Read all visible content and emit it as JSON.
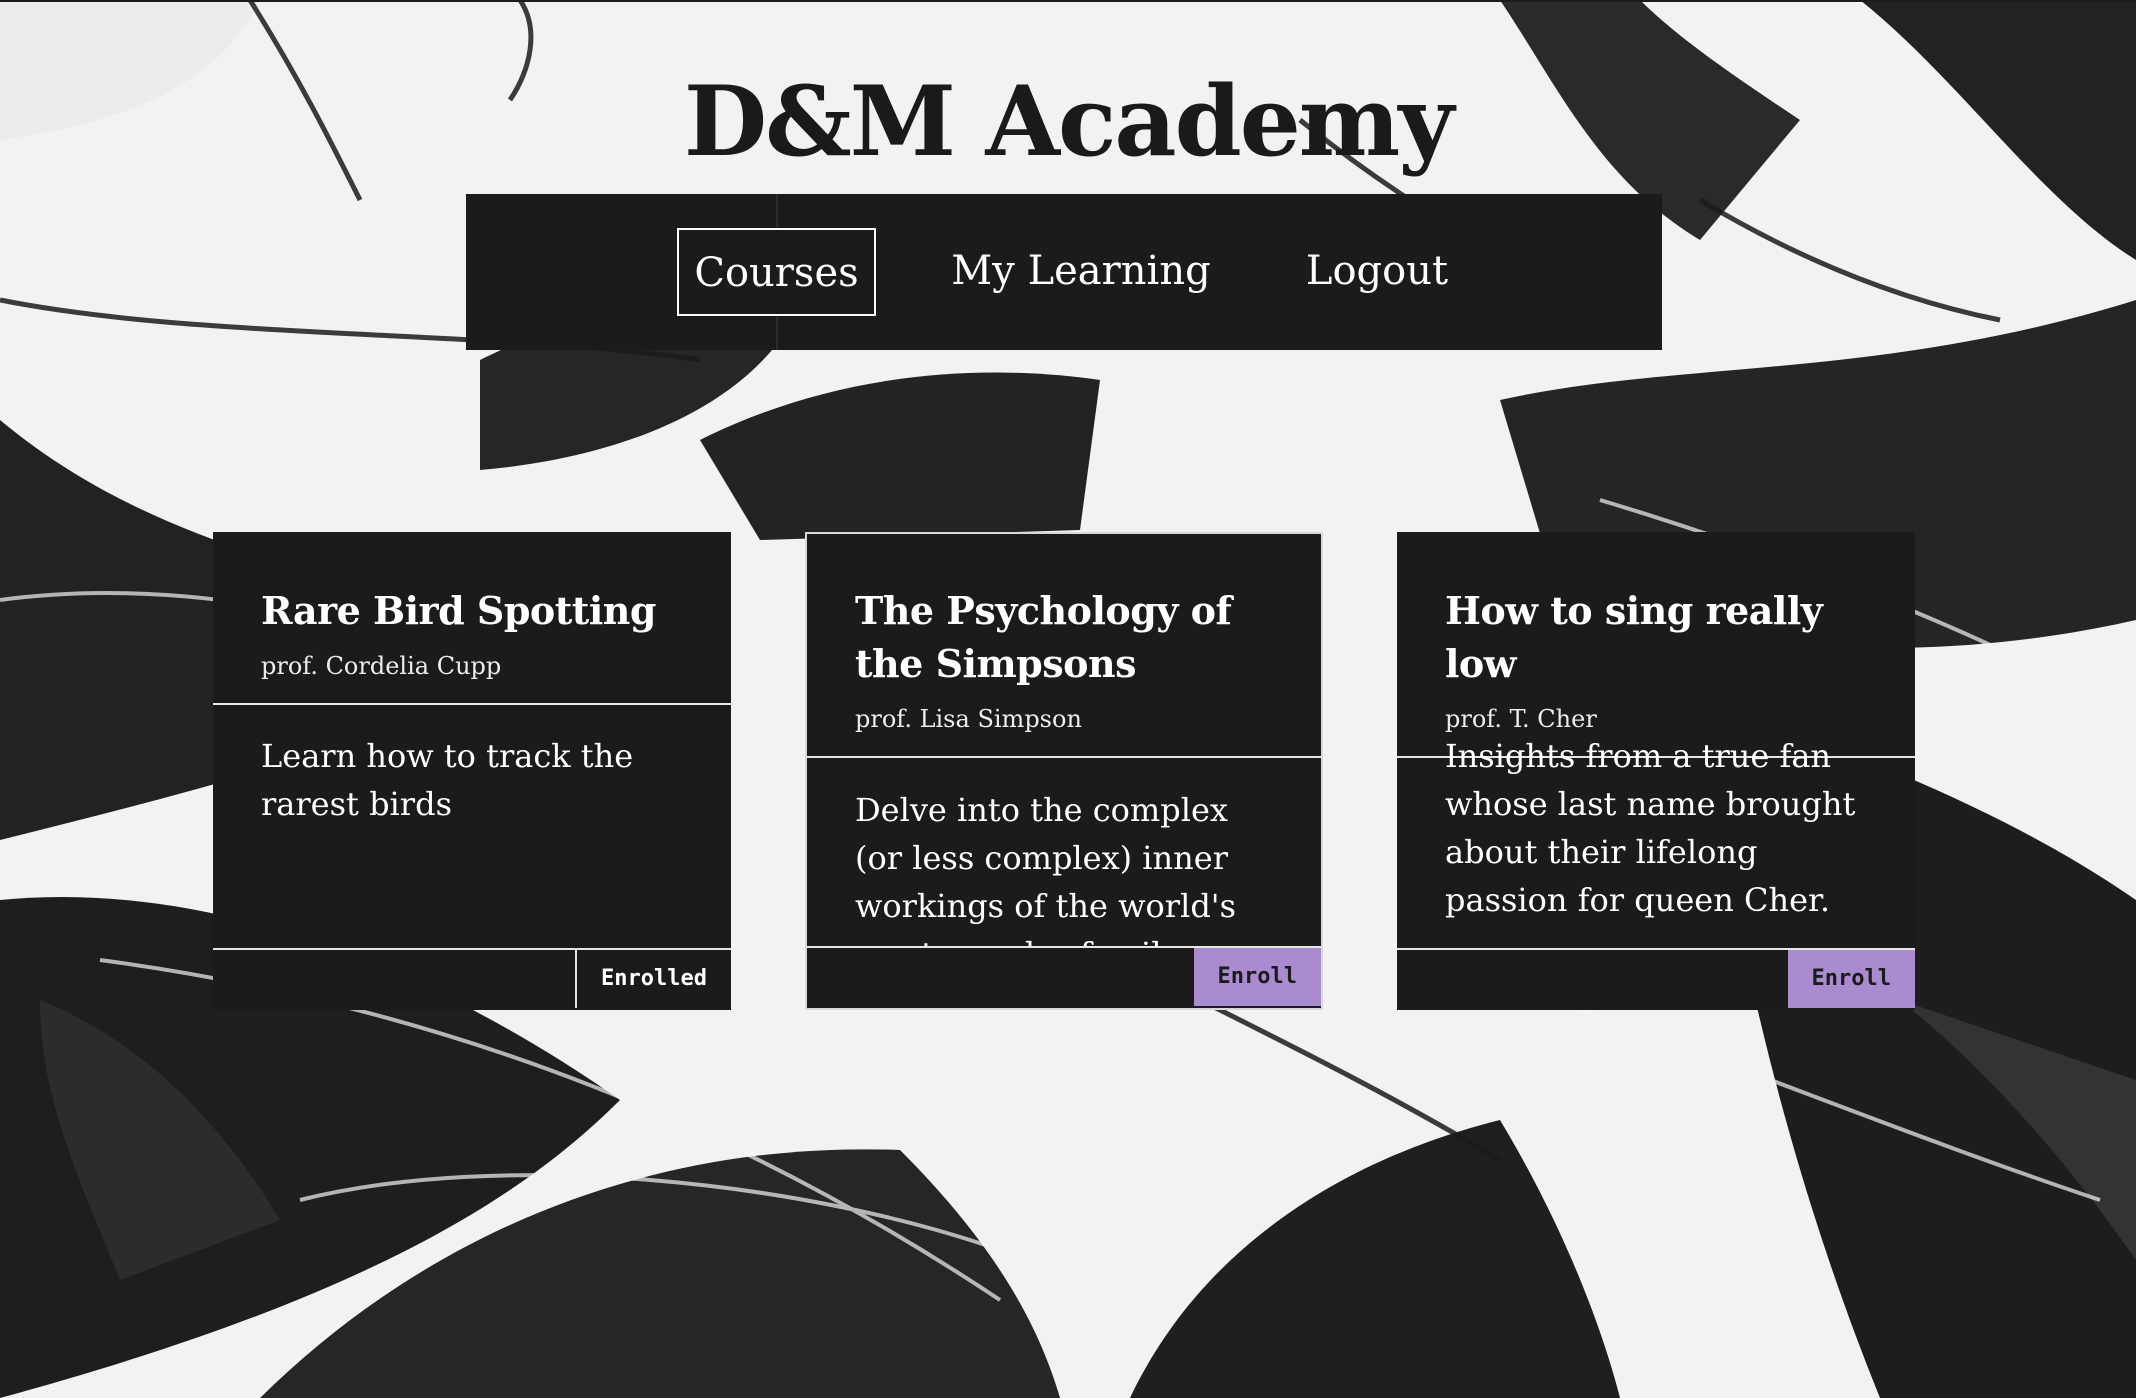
{
  "header": {
    "title": "D&M Academy"
  },
  "nav": {
    "items": [
      {
        "label": "Courses",
        "active": true
      },
      {
        "label": "My Learning"
      },
      {
        "label": "Logout"
      }
    ]
  },
  "courses": [
    {
      "title": "Rare Bird Spotting",
      "professor": "prof. Cordelia Cupp",
      "description": "Learn how to track the rarest birds",
      "button": "Enrolled"
    },
    {
      "title": "The Psychology of the Simpsons",
      "professor": "prof. Lisa Simpson",
      "description": "Delve into the complex (or less complex) inner workings of the world's most popular family",
      "button": "Enroll"
    },
    {
      "title": "How to sing really low",
      "professor": "prof. T. Cher",
      "description": "Insights from a true fan whose last name brought about their lifelong passion for queen Cher.",
      "button": "Enroll"
    }
  ],
  "colors": {
    "accent": "#a98bd0",
    "panel": "#1b1b1b",
    "text": "#ffffff"
  }
}
